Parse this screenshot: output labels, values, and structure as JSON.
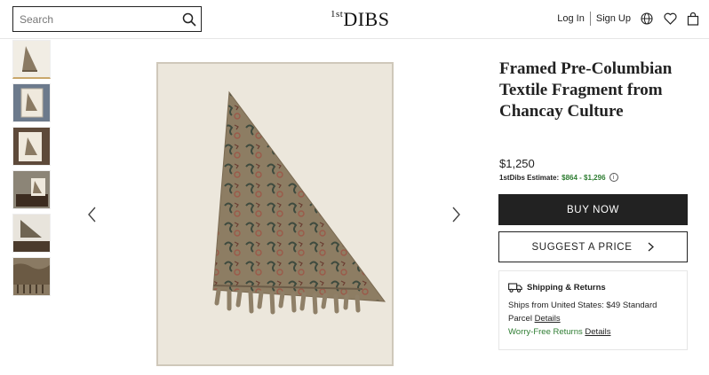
{
  "header": {
    "search_placeholder": "Search",
    "logo_prefix": "1st",
    "logo_main": "DIBS",
    "login_label": "Log In",
    "signup_label": "Sign Up"
  },
  "thumbnails": [
    {
      "name": "textile-closeup"
    },
    {
      "name": "framed-front"
    },
    {
      "name": "framed-angle"
    },
    {
      "name": "framed-room"
    },
    {
      "name": "framed-table"
    },
    {
      "name": "textile-detail"
    }
  ],
  "product": {
    "title": "Framed Pre-Columbian Textile Fragment from Chancay Culture",
    "price": "$1,250",
    "estimate_label": "1stDibs Estimate:",
    "estimate_range": "$864 - $1,296",
    "buy_label": "BUY NOW",
    "suggest_label": "SUGGEST A PRICE"
  },
  "shipping": {
    "heading": "Shipping & Returns",
    "line1": "Ships from United States: $49 Standard",
    "line2_prefix": "Parcel",
    "details_label": "Details",
    "worry_label": "Worry-Free Returns",
    "details2_label": "Details"
  },
  "colors": {
    "accent_gold": "#c9a76b",
    "green": "#2e7d32",
    "dark": "#222222"
  }
}
